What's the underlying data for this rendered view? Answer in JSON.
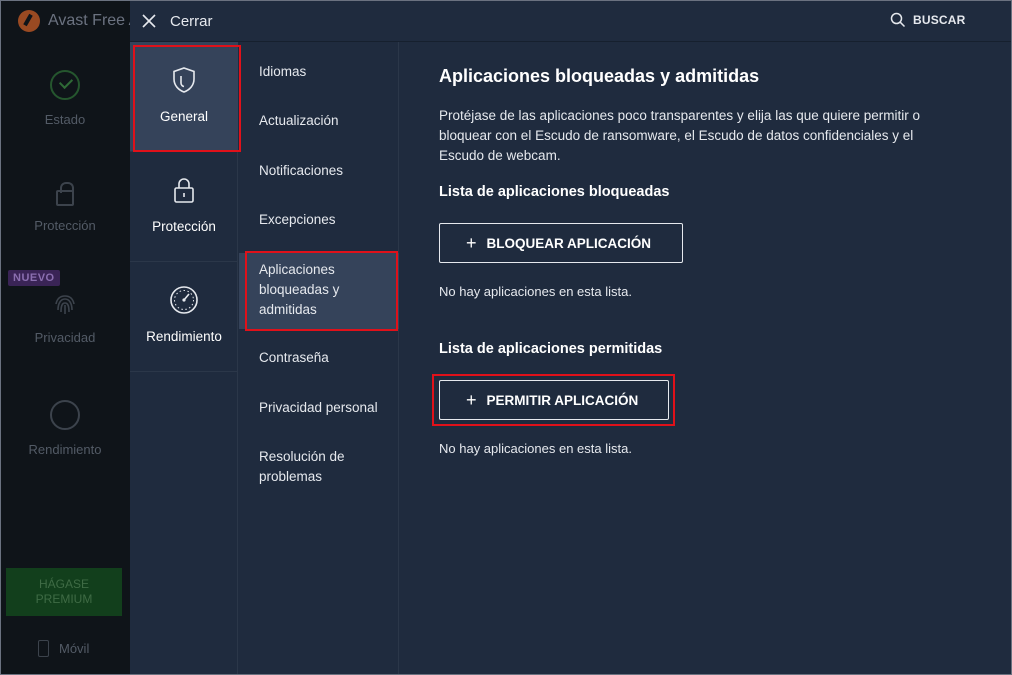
{
  "background_app": {
    "title": "Avast Free A",
    "nav": [
      "Estado",
      "Protección",
      "Privacidad",
      "Rendimiento"
    ],
    "badge_new": "NUEVO",
    "premium_button": "HÁGASE PREMIUM",
    "mobile": "Móvil"
  },
  "topbar": {
    "close_label": "Cerrar",
    "search_label": "BUSCAR"
  },
  "categories": [
    {
      "label": "General",
      "icon": "shield-icon",
      "selected": true
    },
    {
      "label": "Protección",
      "icon": "lock-icon",
      "selected": false
    },
    {
      "label": "Rendimiento",
      "icon": "speedometer-icon",
      "selected": false
    }
  ],
  "subsections": [
    "Idiomas",
    "Actualización",
    "Notificaciones",
    "Excepciones",
    "Aplicaciones bloqueadas y admitidas",
    "Contraseña",
    "Privacidad personal",
    "Resolución de problemas"
  ],
  "selected_subsection": "Aplicaciones bloqueadas y admitidas",
  "content": {
    "title": "Aplicaciones bloqueadas y admitidas",
    "description": "Protéjase de las aplicaciones poco transparentes y elija las que quiere permitir o bloquear con el Escudo de ransomware, el Escudo de datos confidenciales y el Escudo de webcam.",
    "blocked": {
      "heading": "Lista de aplicaciones bloqueadas",
      "button": "BLOQUEAR APLICACIÓN",
      "empty": "No hay aplicaciones en esta lista."
    },
    "allowed": {
      "heading": "Lista de aplicaciones permitidas",
      "button": "PERMITIR APLICACIÓN",
      "empty": "No hay aplicaciones en esta lista."
    }
  },
  "colors": {
    "panel": "#1f2b3e",
    "selected": "#35435a",
    "highlight": "#e0111a",
    "premium": "#123f1c"
  }
}
